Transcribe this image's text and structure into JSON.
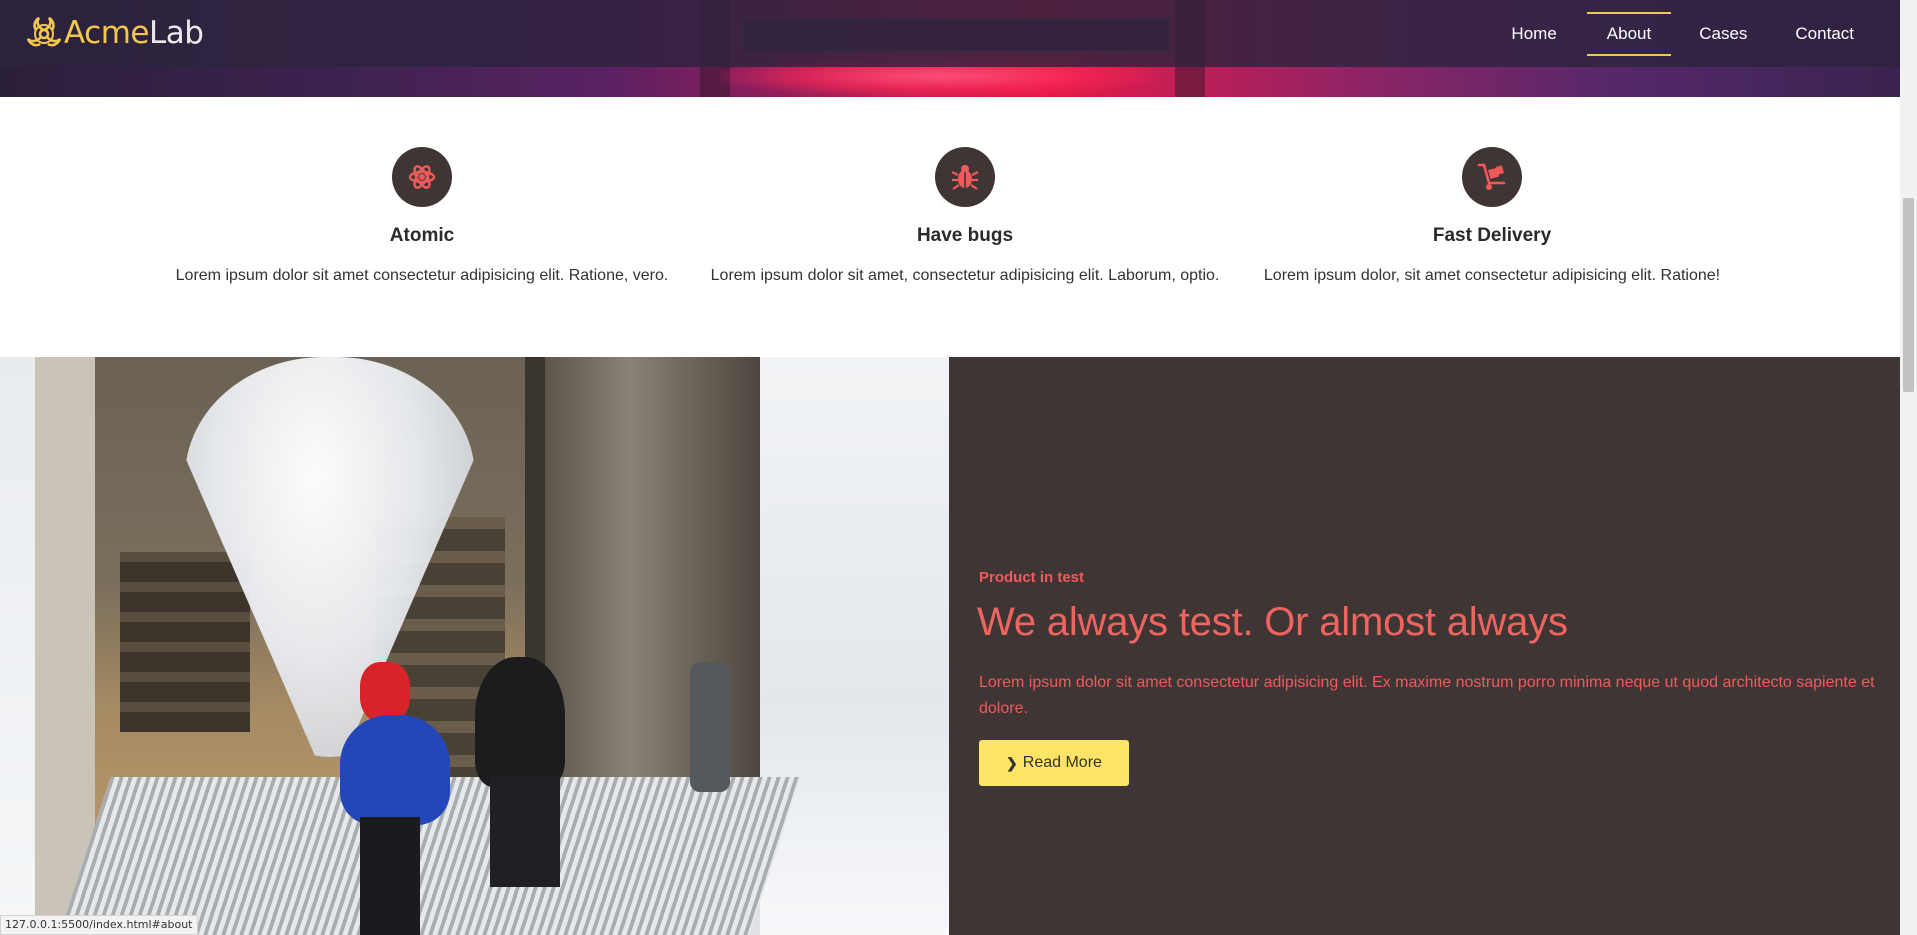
{
  "brand": {
    "acme": "Acme",
    "lab": "Lab",
    "icon": "biohazard-icon",
    "accent": "#f2c84a"
  },
  "nav": {
    "home": "Home",
    "about": "About",
    "cases": "Cases",
    "contact": "Contact",
    "active": "About"
  },
  "features": [
    {
      "icon": "atom-icon",
      "title": "Atomic",
      "text": "Lorem ipsum dolor sit amet consectetur adipisicing elit. Ratione, vero."
    },
    {
      "icon": "bug-icon",
      "title": "Have bugs",
      "text": "Lorem ipsum dolor sit amet, consectetur adipisicing elit. Laborum, optio."
    },
    {
      "icon": "dolly-icon",
      "title": "Fast Delivery",
      "text": "Lorem ipsum dolor, sit amet consectetur adipisicing elit. Ratione!"
    }
  ],
  "promo": {
    "eyebrow": "Product in test",
    "heading": "We always test. Or almost always",
    "body": "Lorem ipsum dolor sit amet consectetur adipisicing elit. Ex maxime nostrum porro minima neque ut quod architecto sapiente et dolore.",
    "button": "Read More",
    "button_icon": "chevron-right-icon",
    "accent": "#f05a5a",
    "button_color": "#fde366",
    "background": "#3f3535"
  },
  "status_url": "127.0.0.1:5500/index.html#about"
}
